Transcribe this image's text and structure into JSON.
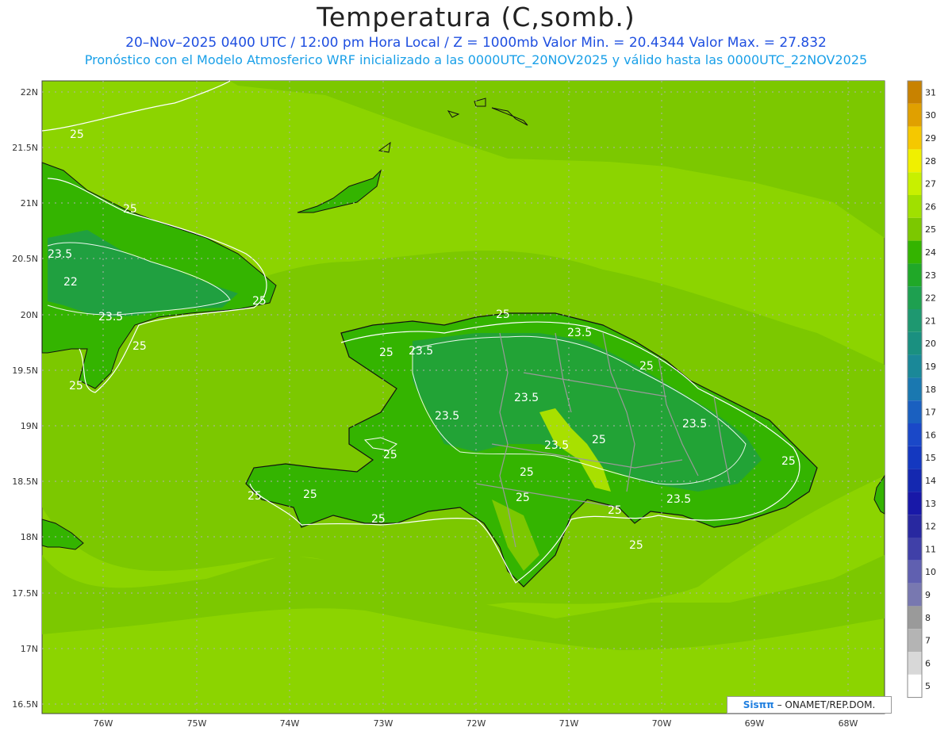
{
  "title": "Temperatura (C,somb.)",
  "subtitle1": "20–Nov–2025 0400 UTC / 12:00 pm Hora Local / Z = 1000mb   Valor Min. = 20.4344  Valor Max. = 27.832",
  "subtitle2": "Pronóstico con el Modelo Atmosferico WRF inicializado a las 0000UTC_20NOV2025 y válido hasta las  0000UTC_22NOV2025",
  "credit": {
    "logo": "SisPi",
    "logo_text": "Sisππ",
    "text": "– ONAMET/REP.DOM."
  },
  "axes": {
    "lat_labels": [
      "22N",
      "21.5N",
      "21N",
      "20.5N",
      "20N",
      "19.5N",
      "19N",
      "18.5N",
      "18N",
      "17.5N",
      "17N",
      "16.5N"
    ],
    "lon_labels": [
      "76W",
      "75W",
      "74W",
      "73W",
      "72W",
      "71W",
      "70W",
      "69W",
      "68W"
    ]
  },
  "colorbar": {
    "levels": [
      "31",
      "30",
      "29",
      "28",
      "27",
      "26",
      "25",
      "24",
      "23",
      "22",
      "21",
      "20",
      "19",
      "18",
      "17",
      "16",
      "15",
      "14",
      "13",
      "12",
      "11",
      "10",
      "9",
      "8",
      "7",
      "6",
      "5"
    ],
    "colors": [
      "#c88200",
      "#e0a000",
      "#f5c800",
      "#f0f000",
      "#c8f000",
      "#a0e000",
      "#7cc800",
      "#34b400",
      "#20a828",
      "#1ea050",
      "#1e9870",
      "#1a9080",
      "#1a8898",
      "#1a78b0",
      "#1a60c0",
      "#1a48c8",
      "#1438c0",
      "#1428b0",
      "#1818a8",
      "#2828a0",
      "#4040a8",
      "#6060b0",
      "#7878b0",
      "#9a9a9a",
      "#b4b4b4",
      "#d8d8d8",
      "#ffffff"
    ]
  },
  "contour_labels": [
    {
      "text": "25"
    },
    {
      "text": "25"
    },
    {
      "text": "23.5"
    },
    {
      "text": "22"
    },
    {
      "text": "25"
    },
    {
      "text": "23.5"
    },
    {
      "text": "25"
    },
    {
      "text": "25"
    },
    {
      "text": "25"
    },
    {
      "text": "23.5"
    },
    {
      "text": "25"
    },
    {
      "text": "23.5"
    },
    {
      "text": "25"
    },
    {
      "text": "23.5"
    },
    {
      "text": "23.5"
    },
    {
      "text": "23.5"
    },
    {
      "text": "23.5"
    },
    {
      "text": "25"
    },
    {
      "text": "25"
    },
    {
      "text": "25"
    },
    {
      "text": "25"
    },
    {
      "text": "25"
    },
    {
      "text": "25"
    },
    {
      "text": "25"
    },
    {
      "text": "23.5"
    },
    {
      "text": "25"
    },
    {
      "text": "25"
    },
    {
      "text": "25"
    }
  ],
  "colors": {
    "ocean": "#8cd400",
    "ocean_light": "#90d800",
    "land": "#34b400",
    "land_dark": "#20a040",
    "warm": "#a8e000"
  }
}
